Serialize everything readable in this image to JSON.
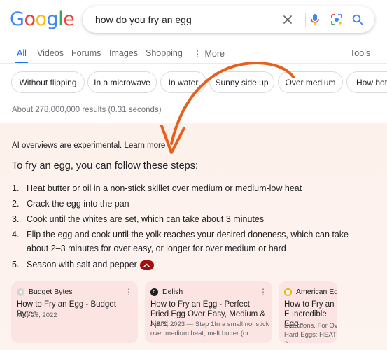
{
  "search": {
    "query": "how do you fry an egg"
  },
  "tabs": [
    "All",
    "Videos",
    "Forums",
    "Images",
    "Shopping",
    "More",
    "Tools"
  ],
  "chips": [
    "Without flipping",
    "In a microwave",
    "In water",
    "Sunny side up",
    "Over medium",
    "How hot"
  ],
  "results_count": "About 278,000,000 results (0.31 seconds)",
  "ai_overview": {
    "note": "AI overviews are experimental.",
    "learn_more": "Learn more",
    "heading": "To fry an egg, you can follow these steps:",
    "steps": [
      {
        "num": "1.",
        "text": "Heat butter or oil in a non-stick skillet over medium or medium-low heat"
      },
      {
        "num": "2.",
        "text": "Crack the egg into the pan"
      },
      {
        "num": "3.",
        "text": "Cook until the whites are set, which can take about 3 minutes"
      },
      {
        "num": "4.",
        "text": "Flip the egg and cook until the yolk reaches your desired doneness, which can take about 2–3 minutes for over easy, or longer for over medium or hard"
      },
      {
        "num": "5.",
        "text": "Season with salt and pepper"
      }
    ]
  },
  "cards": [
    {
      "source": "Budget Bytes",
      "title": "How to Fry an Egg - Budget Bytes",
      "meta": "May 25, 2022"
    },
    {
      "source": "Delish",
      "title": "How to Fry an Egg - Perfect Fried Egg Over Easy, Medium & Hard...",
      "meta": "Apr 5, 2023 — Step 1In a small nonstick over medium heat, melt butter (or..."
    },
    {
      "source": "American Egg",
      "title": "How to Fry an E Incredible Egg -",
      "meta": "Directions. For Ov Hard Eggs: HEAT 2"
    }
  ],
  "colors": {
    "accent": "#1a73e8",
    "arrow": "#e8601c",
    "panel_bg": "#fdf1ec",
    "card_bg": "#fbe4e1",
    "collapse": "#a50e0e"
  },
  "logo_text": "Google"
}
